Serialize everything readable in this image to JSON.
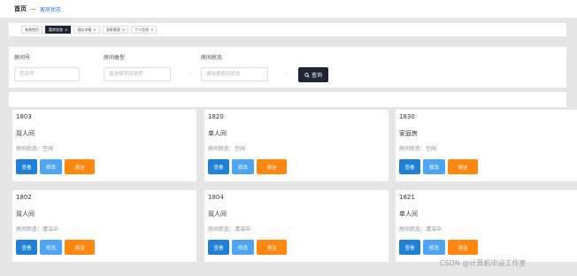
{
  "breadcrumb": {
    "home": "首页",
    "separator": "—",
    "current": "客房状态"
  },
  "tabs": [
    {
      "label": "系统首页",
      "active": false,
      "closable": false
    },
    {
      "label": "客房状态",
      "active": true,
      "closable": true
    },
    {
      "label": "酒店详情",
      "active": false,
      "closable": true
    },
    {
      "label": "消息管理",
      "active": false,
      "closable": true
    },
    {
      "label": "个人信息",
      "active": false,
      "closable": true
    }
  ],
  "close_glyph": "×",
  "filters": {
    "room_no": {
      "label": "房间号",
      "placeholder": "房间号"
    },
    "room_type": {
      "label": "房间类型",
      "placeholder": "请选择房间类型"
    },
    "room_status": {
      "label": "房间状态",
      "placeholder": "请选择房间状态"
    },
    "query_label": "查询",
    "chevron": "⌄"
  },
  "cards": [
    {
      "number": "1803",
      "type": "双人间",
      "status": "房间状态：空闲"
    },
    {
      "number": "1820",
      "type": "单人间",
      "status": "房间状态：空闲"
    },
    {
      "number": "1830",
      "type": "家庭房",
      "status": "房间状态：空闲"
    },
    {
      "number": "1802",
      "type": "双人间",
      "status": "房间状态：清洁中"
    },
    {
      "number": "1804",
      "type": "双人间",
      "status": "房间状态：清洁中"
    },
    {
      "number": "1821",
      "type": "单人间",
      "status": "房间状态：清洁中"
    }
  ],
  "card_buttons": {
    "view": "查看",
    "edit": "修改",
    "clean": "清洁"
  },
  "colors": {
    "primary_dark": "#1f2533",
    "view": "#1e80d6",
    "edit": "#4ea5f3",
    "clean": "#ff8710",
    "link": "#2a6fd6"
  },
  "watermark": "CSDN @计算机毕设工作室"
}
